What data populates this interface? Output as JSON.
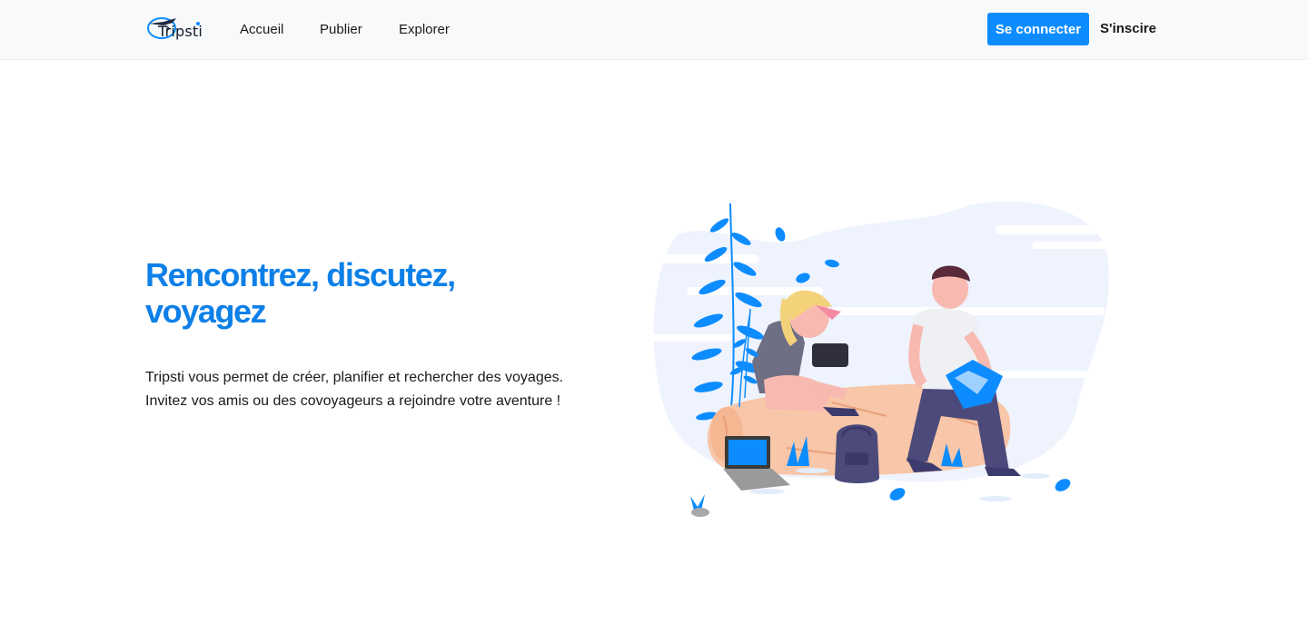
{
  "nav": {
    "brand": "Tripsti",
    "links": [
      "Accueil",
      "Publier",
      "Explorer"
    ],
    "login_label": "Se connecter",
    "signup_label": "S'inscire"
  },
  "hero": {
    "title": "Rencontrez, discutez, voyagez",
    "description": "Tripsti vous permet de créer, planifier et rechercher des voyages. Invitez vos amis ou des covoyageurs a rejoindre votre aventure !"
  },
  "illustration": {
    "name": "travelers-illustration",
    "accent": "#0d80e8",
    "background_blob": "#eef3fd"
  },
  "colors": {
    "primary": "#0d8cff",
    "title": "#0d80e8",
    "navbar_bg": "#f8f9fa"
  }
}
